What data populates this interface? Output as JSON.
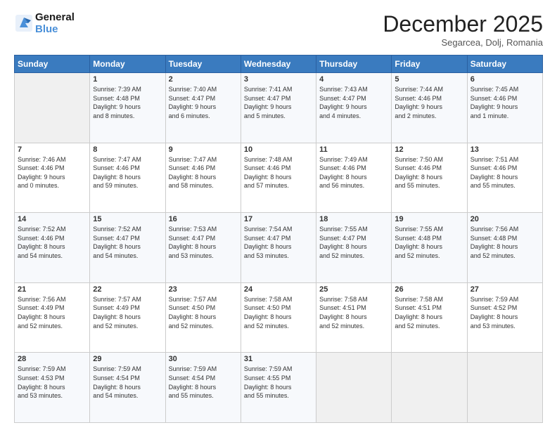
{
  "logo": {
    "line1": "General",
    "line2": "Blue"
  },
  "title": "December 2025",
  "subtitle": "Segarcea, Dolj, Romania",
  "header_days": [
    "Sunday",
    "Monday",
    "Tuesday",
    "Wednesday",
    "Thursday",
    "Friday",
    "Saturday"
  ],
  "weeks": [
    [
      {
        "day": "",
        "info": ""
      },
      {
        "day": "1",
        "info": "Sunrise: 7:39 AM\nSunset: 4:48 PM\nDaylight: 9 hours\nand 8 minutes."
      },
      {
        "day": "2",
        "info": "Sunrise: 7:40 AM\nSunset: 4:47 PM\nDaylight: 9 hours\nand 6 minutes."
      },
      {
        "day": "3",
        "info": "Sunrise: 7:41 AM\nSunset: 4:47 PM\nDaylight: 9 hours\nand 5 minutes."
      },
      {
        "day": "4",
        "info": "Sunrise: 7:43 AM\nSunset: 4:47 PM\nDaylight: 9 hours\nand 4 minutes."
      },
      {
        "day": "5",
        "info": "Sunrise: 7:44 AM\nSunset: 4:46 PM\nDaylight: 9 hours\nand 2 minutes."
      },
      {
        "day": "6",
        "info": "Sunrise: 7:45 AM\nSunset: 4:46 PM\nDaylight: 9 hours\nand 1 minute."
      }
    ],
    [
      {
        "day": "7",
        "info": "Sunrise: 7:46 AM\nSunset: 4:46 PM\nDaylight: 9 hours\nand 0 minutes."
      },
      {
        "day": "8",
        "info": "Sunrise: 7:47 AM\nSunset: 4:46 PM\nDaylight: 8 hours\nand 59 minutes."
      },
      {
        "day": "9",
        "info": "Sunrise: 7:47 AM\nSunset: 4:46 PM\nDaylight: 8 hours\nand 58 minutes."
      },
      {
        "day": "10",
        "info": "Sunrise: 7:48 AM\nSunset: 4:46 PM\nDaylight: 8 hours\nand 57 minutes."
      },
      {
        "day": "11",
        "info": "Sunrise: 7:49 AM\nSunset: 4:46 PM\nDaylight: 8 hours\nand 56 minutes."
      },
      {
        "day": "12",
        "info": "Sunrise: 7:50 AM\nSunset: 4:46 PM\nDaylight: 8 hours\nand 55 minutes."
      },
      {
        "day": "13",
        "info": "Sunrise: 7:51 AM\nSunset: 4:46 PM\nDaylight: 8 hours\nand 55 minutes."
      }
    ],
    [
      {
        "day": "14",
        "info": "Sunrise: 7:52 AM\nSunset: 4:46 PM\nDaylight: 8 hours\nand 54 minutes."
      },
      {
        "day": "15",
        "info": "Sunrise: 7:52 AM\nSunset: 4:47 PM\nDaylight: 8 hours\nand 54 minutes."
      },
      {
        "day": "16",
        "info": "Sunrise: 7:53 AM\nSunset: 4:47 PM\nDaylight: 8 hours\nand 53 minutes."
      },
      {
        "day": "17",
        "info": "Sunrise: 7:54 AM\nSunset: 4:47 PM\nDaylight: 8 hours\nand 53 minutes."
      },
      {
        "day": "18",
        "info": "Sunrise: 7:55 AM\nSunset: 4:47 PM\nDaylight: 8 hours\nand 52 minutes."
      },
      {
        "day": "19",
        "info": "Sunrise: 7:55 AM\nSunset: 4:48 PM\nDaylight: 8 hours\nand 52 minutes."
      },
      {
        "day": "20",
        "info": "Sunrise: 7:56 AM\nSunset: 4:48 PM\nDaylight: 8 hours\nand 52 minutes."
      }
    ],
    [
      {
        "day": "21",
        "info": "Sunrise: 7:56 AM\nSunset: 4:49 PM\nDaylight: 8 hours\nand 52 minutes."
      },
      {
        "day": "22",
        "info": "Sunrise: 7:57 AM\nSunset: 4:49 PM\nDaylight: 8 hours\nand 52 minutes."
      },
      {
        "day": "23",
        "info": "Sunrise: 7:57 AM\nSunset: 4:50 PM\nDaylight: 8 hours\nand 52 minutes."
      },
      {
        "day": "24",
        "info": "Sunrise: 7:58 AM\nSunset: 4:50 PM\nDaylight: 8 hours\nand 52 minutes."
      },
      {
        "day": "25",
        "info": "Sunrise: 7:58 AM\nSunset: 4:51 PM\nDaylight: 8 hours\nand 52 minutes."
      },
      {
        "day": "26",
        "info": "Sunrise: 7:58 AM\nSunset: 4:51 PM\nDaylight: 8 hours\nand 52 minutes."
      },
      {
        "day": "27",
        "info": "Sunrise: 7:59 AM\nSunset: 4:52 PM\nDaylight: 8 hours\nand 53 minutes."
      }
    ],
    [
      {
        "day": "28",
        "info": "Sunrise: 7:59 AM\nSunset: 4:53 PM\nDaylight: 8 hours\nand 53 minutes."
      },
      {
        "day": "29",
        "info": "Sunrise: 7:59 AM\nSunset: 4:54 PM\nDaylight: 8 hours\nand 54 minutes."
      },
      {
        "day": "30",
        "info": "Sunrise: 7:59 AM\nSunset: 4:54 PM\nDaylight: 8 hours\nand 55 minutes."
      },
      {
        "day": "31",
        "info": "Sunrise: 7:59 AM\nSunset: 4:55 PM\nDaylight: 8 hours\nand 55 minutes."
      },
      {
        "day": "",
        "info": ""
      },
      {
        "day": "",
        "info": ""
      },
      {
        "day": "",
        "info": ""
      }
    ]
  ]
}
